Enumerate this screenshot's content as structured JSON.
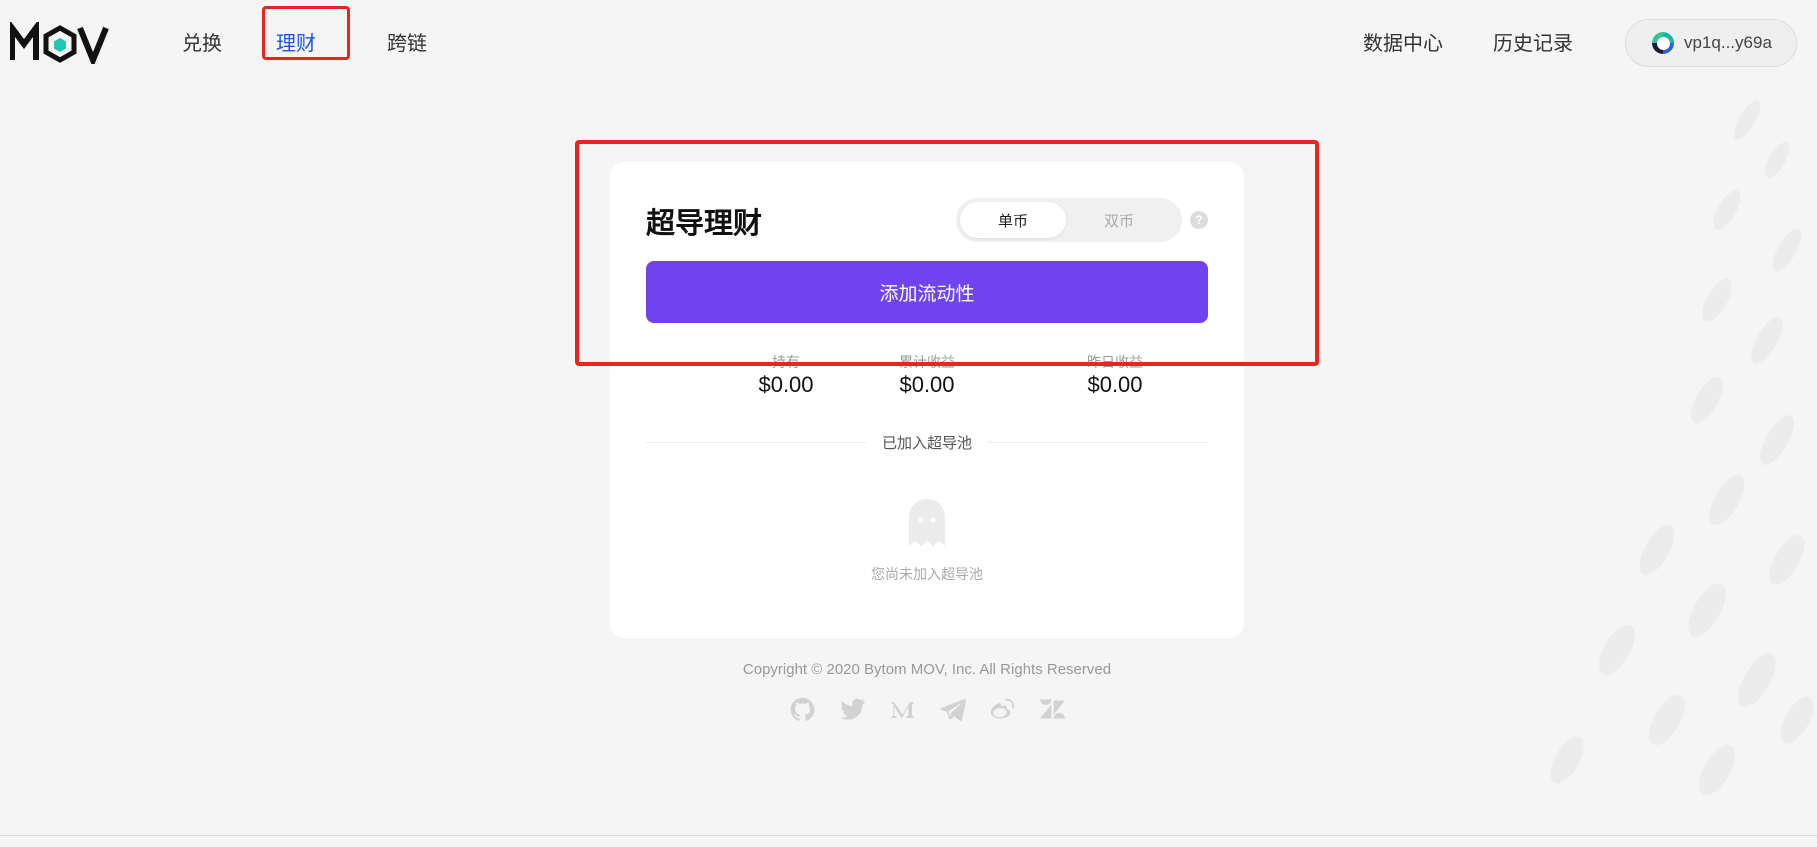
{
  "header": {
    "logo_text": "MOV",
    "nav": [
      {
        "label": "兑换",
        "active": false
      },
      {
        "label": "理财",
        "active": true
      },
      {
        "label": "跨链",
        "active": false
      }
    ],
    "right_nav": [
      {
        "label": "数据中心"
      },
      {
        "label": "历史记录"
      }
    ],
    "wallet_address": "vp1q...y69a"
  },
  "card": {
    "title": "超导理财",
    "toggle": [
      {
        "label": "单币",
        "active": true
      },
      {
        "label": "双币",
        "active": false
      }
    ],
    "help_symbol": "?",
    "add_button_label": "添加流动性",
    "stats": [
      {
        "label": "持有",
        "value": "$0.00"
      },
      {
        "label": "累计收益",
        "value": "$0.00"
      },
      {
        "label": "昨日收益",
        "value": "$0.00"
      }
    ],
    "section_label": "已加入超导池",
    "empty_text": "您尚未加入超导池",
    "empty_icon": "ghost-icon"
  },
  "footer": {
    "copyright": "Copyright © 2020 Bytom MOV, Inc. All Rights Reserved",
    "socials": [
      "github-icon",
      "twitter-icon",
      "medium-icon",
      "telegram-icon",
      "weibo-icon",
      "zendesk-icon"
    ]
  },
  "colors": {
    "accent": "#6f44ee",
    "active_nav": "#1a56e8",
    "highlight_box": "#e8251f",
    "background": "#f5f5f6"
  }
}
